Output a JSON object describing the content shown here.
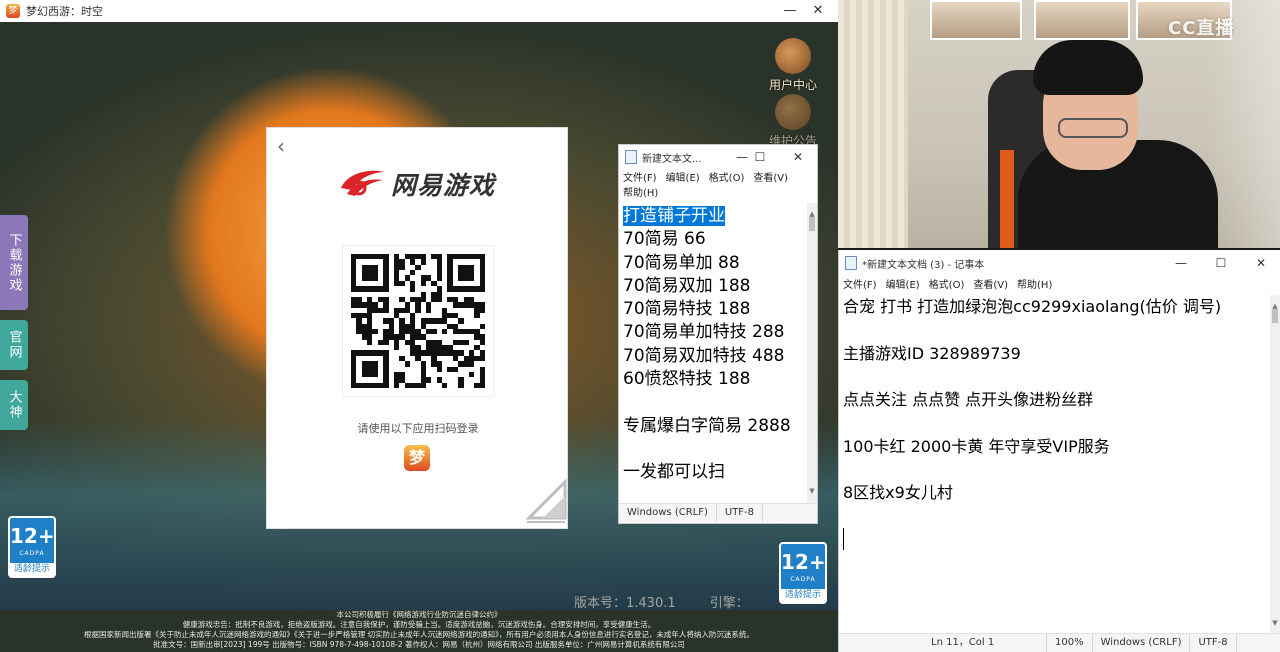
{
  "game": {
    "window_title": "梦幻西游：时空",
    "app_icon": "梦",
    "controls": {
      "minimize": "—",
      "close": "✕"
    },
    "side_tabs": {
      "download": "下载游戏",
      "official": "官网",
      "dashen": "大神"
    },
    "corner_buttons": {
      "user_center": "用户中心",
      "notice": "维护公告"
    },
    "age_badge": {
      "number": "12+",
      "cadpa": "CADPA",
      "hint": "适龄提示"
    },
    "version": "版本号：1.430.1",
    "version_extra": "引擎：",
    "footer_lines": [
      "本公司积极履行《网络游戏行业防沉迷自律公约》",
      "健康游戏忠告：抵制不良游戏，拒绝盗版游戏。注意自我保护，谨防受骗上当。适度游戏益脑，沉迷游戏伤身。合理安排时间，享受健康生活。",
      "根据国家新闻出版署《关于防止未成年人沉迷网络游戏的通知》《关于进一步严格管理 切实防止未成年人沉迷网络游戏的通知》，所有用户必须用本人身份信息进行实名登记，未成年人将纳入防沉迷系统。",
      "批准文号：国新出审[2023] 199号  出版物号：ISBN 978-7-498-10108-2  著作权人：网易（杭州）网络有限公司  出版服务单位：广州网易计算机系统有限公司"
    ],
    "login": {
      "back": "‹",
      "brand": "网易游戏",
      "hint": "请使用以下应用扫码登录",
      "app_icon": "梦"
    }
  },
  "notepad_small": {
    "title": "新建文本文...",
    "controls": {
      "minimize": "—",
      "maximize": "☐",
      "close": "✕"
    },
    "menu": [
      "文件(F)",
      "编辑(E)",
      "格式(O)",
      "查看(V)",
      "帮助(H)"
    ],
    "lines": [
      "打造铺子开业",
      "70简易  66",
      "70简易单加  88",
      "70简易双加  188",
      "70简易特技   188",
      "70简易单加特技 288",
      "70简易双加特技 488",
      "60愤怒特技  188",
      "",
      "专属爆白字简易 2888",
      "",
      "一发都可以扫"
    ],
    "status": {
      "line_ending": "Windows (CRLF)",
      "encoding": "UTF-8"
    }
  },
  "webcam": {
    "logo": "CC直播"
  },
  "notepad_big": {
    "title": "*新建文本文档 (3) - 记事本",
    "controls": {
      "minimize": "—",
      "maximize": "☐",
      "close": "✕"
    },
    "menu": [
      "文件(F)",
      "编辑(E)",
      "格式(O)",
      "查看(V)",
      "帮助(H)"
    ],
    "lines": [
      "合宠 打书 打造加绿泡泡cc9299xiaolang(估价 调号)",
      "",
      "主播游戏ID 328989739",
      "",
      "点点关注  点点赞   点开头像进粉丝群",
      "",
      "100卡红  2000卡黄 年守享受VIP服务",
      "",
      "8区找x9女儿村",
      ""
    ],
    "status": {
      "position": "Ln 11，Col 1",
      "zoom": "100%",
      "line_ending": "Windows (CRLF)",
      "encoding": "UTF-8"
    }
  }
}
